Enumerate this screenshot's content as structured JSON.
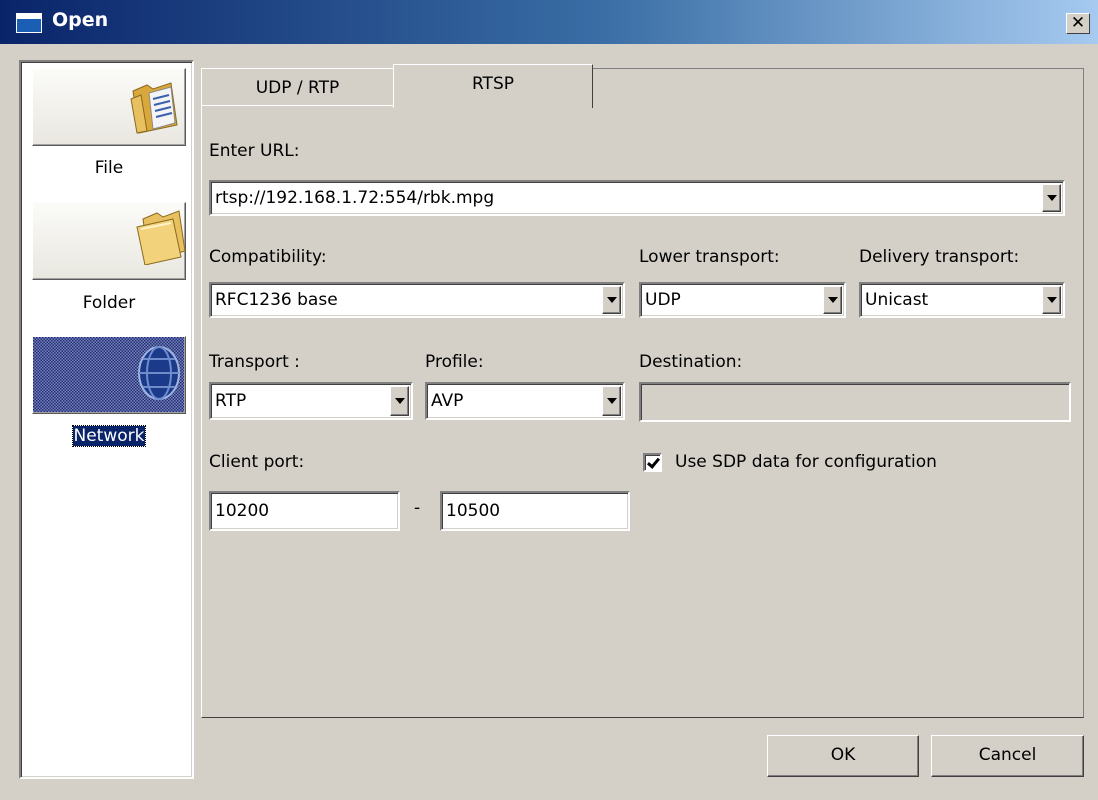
{
  "window": {
    "title": "Open",
    "close_symbol": "✕"
  },
  "sidebar": {
    "items": [
      {
        "label": "File",
        "icon": "file-icon",
        "selected": false
      },
      {
        "label": "Folder",
        "icon": "folder-icon",
        "selected": false
      },
      {
        "label": "Network",
        "icon": "network-icon",
        "selected": true
      }
    ]
  },
  "tabs": [
    {
      "label": "UDP / RTP",
      "active": false
    },
    {
      "label": "RTSP",
      "active": true
    }
  ],
  "form": {
    "url_label": "Enter URL:",
    "url_value": "rtsp://192.168.1.72:554/rbk.mpg",
    "compatibility_label": "Compatibility:",
    "compatibility_value": "RFC1236 base",
    "lower_transport_label": "Lower transport:",
    "lower_transport_value": "UDP",
    "delivery_transport_label": "Delivery transport:",
    "delivery_transport_value": "Unicast",
    "transport_label": "Transport :",
    "transport_value": "RTP",
    "profile_label": "Profile:",
    "profile_value": "AVP",
    "destination_label": "Destination:",
    "destination_value": "",
    "client_port_label": "Client port:",
    "client_port_from": "10200",
    "port_separator": "-",
    "client_port_to": "10500",
    "use_sdp_label": "Use SDP data for configuration",
    "use_sdp_checked": true
  },
  "buttons": {
    "ok": "OK",
    "cancel": "Cancel"
  }
}
